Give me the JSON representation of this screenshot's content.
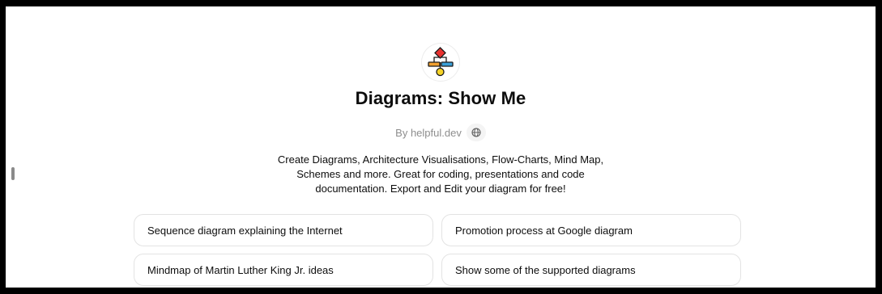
{
  "gpt": {
    "logo_icon": "flowchart-diagram-icon",
    "title": "Diagrams: Show Me",
    "byline": "By helpful.dev",
    "website_icon": "globe-icon",
    "description_lines": [
      "Create Diagrams, Architecture Visualisations, Flow-Charts, Mind Map,",
      "Schemes and more. Great for coding, presentations and code",
      "documentation. Export and Edit your diagram for free!"
    ]
  },
  "prompts": [
    "Sequence diagram explaining the Internet",
    "Promotion process at Google diagram",
    "Mindmap of Martin Luther King Jr. ideas",
    "Show some of the supported diagrams"
  ],
  "colors": {
    "logo_red": "#e8312f",
    "logo_orange": "#f0a030",
    "logo_blue": "#3aa0d8",
    "logo_yellow": "#f5d327",
    "outline": "#1a1a1a"
  }
}
